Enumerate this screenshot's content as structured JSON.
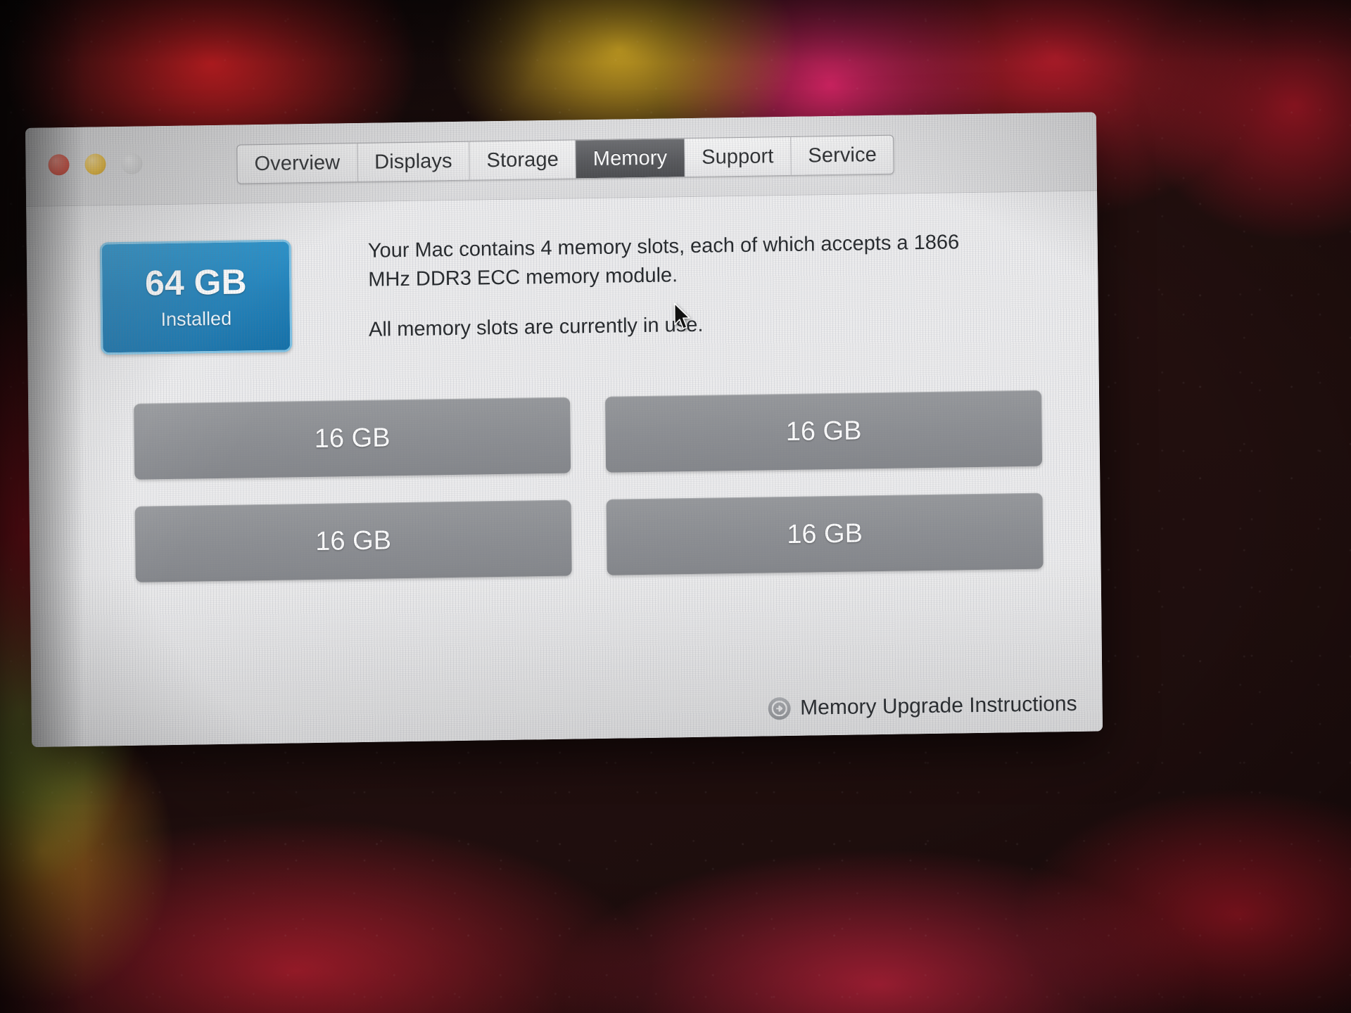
{
  "window": {
    "traffic_lights": [
      {
        "name": "close",
        "color": "#ea4a36"
      },
      {
        "name": "minimize",
        "color": "#f0bc2e"
      },
      {
        "name": "zoom",
        "color": "#d8d8d8"
      }
    ],
    "tabs": [
      {
        "label": "Overview",
        "active": false
      },
      {
        "label": "Displays",
        "active": false
      },
      {
        "label": "Storage",
        "active": false
      },
      {
        "label": "Memory",
        "active": true
      },
      {
        "label": "Support",
        "active": false
      },
      {
        "label": "Service",
        "active": false
      }
    ]
  },
  "memory": {
    "badge": {
      "amount": "64 GB",
      "status": "Installed",
      "accent_color": "#1b7fb9"
    },
    "description": {
      "paragraph1": "Your Mac contains 4 memory slots, each of which accepts a 1866 MHz DDR3 ECC memory module.",
      "paragraph2": "All memory slots are currently in use."
    },
    "slots": [
      {
        "label": "16 GB"
      },
      {
        "label": "16 GB"
      },
      {
        "label": "16 GB"
      },
      {
        "label": "16 GB"
      }
    ],
    "upgrade_link": {
      "label": "Memory Upgrade Instructions",
      "icon": "arrow-right-circle-icon"
    }
  }
}
